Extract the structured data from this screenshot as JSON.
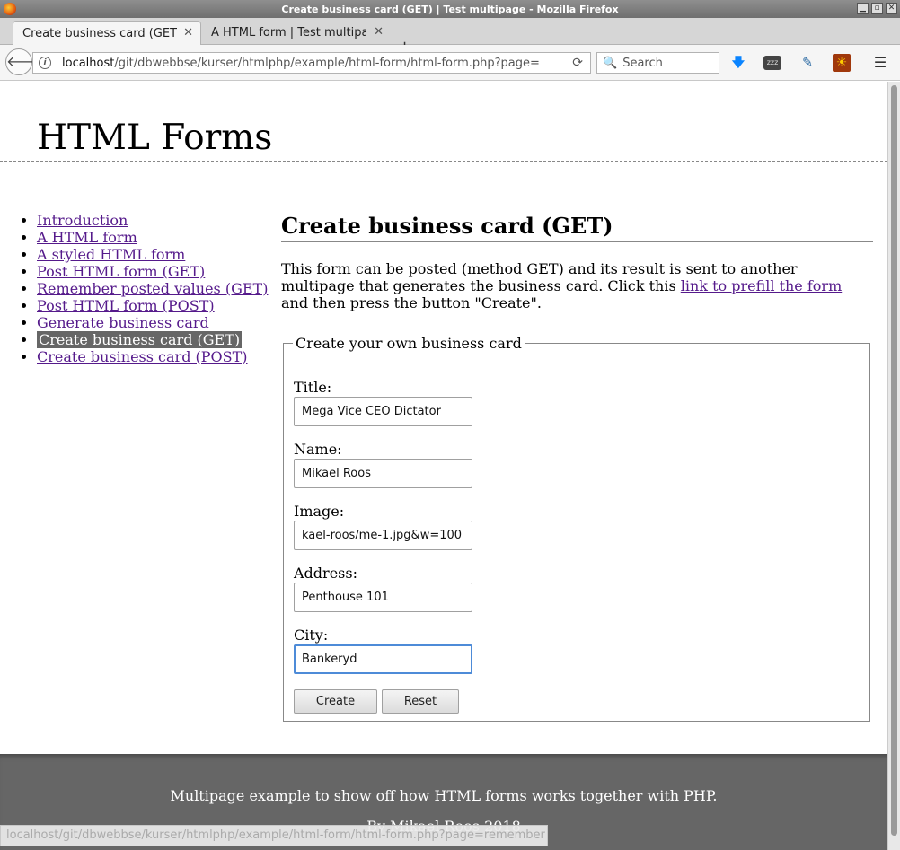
{
  "window": {
    "title": "Create business card (GET) | Test multipage - Mozilla Firefox",
    "buttons": [
      "▁",
      "▫",
      "✕"
    ]
  },
  "tabs": [
    {
      "label": "Create business card (GET) | Test multipage",
      "close": "✕"
    },
    {
      "label": "A HTML form | Test multipage",
      "close": "✕"
    }
  ],
  "toolbar": {
    "new_tab": "+",
    "back": "🡐",
    "url_host": "localhost",
    "url_path": "/git/dbwebbse/kurser/htmlphp/example/html-form/html-form.php?page=",
    "reload": "⟳",
    "search_placeholder": "Search",
    "search_icon": "🔍",
    "download_icon": "🡇",
    "zzz_label": "zzz",
    "picker_icon": "✎",
    "sun_icon": "☀",
    "menu_icon": "☰",
    "info_icon": "i"
  },
  "site": {
    "title": "HTML Forms"
  },
  "nav": {
    "items": [
      {
        "label": "Introduction"
      },
      {
        "label": "A HTML form"
      },
      {
        "label": "A styled HTML form"
      },
      {
        "label": "Post HTML form (GET)"
      },
      {
        "label": "Remember posted values (GET)"
      },
      {
        "label": "Post HTML form (POST)"
      },
      {
        "label": "Generate business card"
      },
      {
        "label": "Create business card (GET)",
        "selected": true
      },
      {
        "label": "Create business card (POST)"
      }
    ]
  },
  "main": {
    "heading": "Create business card (GET)",
    "intro_before": "This form can be posted (method GET) and its result is sent to another multipage that generates the business card. Click this ",
    "intro_link": "link to prefill the form",
    "intro_after": " and then press the button \"Create\"."
  },
  "form": {
    "legend": "Create your own business card",
    "fields": [
      {
        "label": "Title:",
        "value": "Mega Vice CEO Dictator"
      },
      {
        "label": "Name:",
        "value": "Mikael Roos"
      },
      {
        "label": "Image:",
        "value": "kael-roos/me-1.jpg&w=100"
      },
      {
        "label": "Address:",
        "value": "Penthouse 101"
      },
      {
        "label": "City:",
        "value": "Bankeryd"
      }
    ],
    "create_label": "Create",
    "reset_label": "Reset"
  },
  "footer": {
    "line1": "Multipage example to show off how HTML forms works together with PHP.",
    "line2": "By Mikael Roos 2018"
  },
  "status_url": "localhost/git/dbwebbse/kurser/htmlphp/example/html-form/html-form.php?page=remember"
}
